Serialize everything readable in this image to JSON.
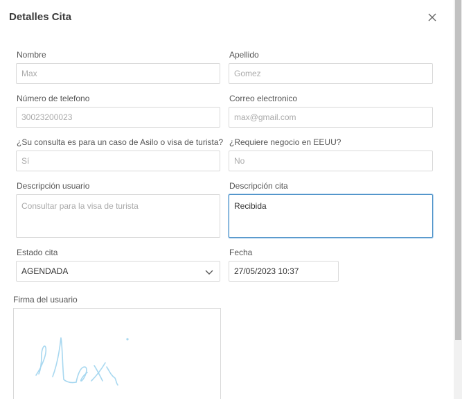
{
  "modal": {
    "title": "Detalles Cita"
  },
  "fields": {
    "nombre": {
      "label": "Nombre",
      "value": "Max"
    },
    "apellido": {
      "label": "Apellido",
      "value": "Gomez"
    },
    "telefono": {
      "label": "Número de telefono",
      "value": "30023200023"
    },
    "correo": {
      "label": "Correo electronico",
      "value": "max@gmail.com"
    },
    "asilo": {
      "label": "¿Su consulta es para un caso de Asilo o visa de turista?",
      "value": "Sí"
    },
    "negocio": {
      "label": "¿Requiere negocio en EEUU?",
      "value": "No"
    },
    "desc_usuario": {
      "label": "Descripción usuario",
      "value": "Consultar para la visa de turista"
    },
    "desc_cita": {
      "label": "Descripción cita",
      "value": "Recibida"
    },
    "estado": {
      "label": "Estado cita",
      "value": "AGENDADA"
    },
    "fecha": {
      "label": "Fecha",
      "value": "27/05/2023 10:37"
    },
    "firma": {
      "label": "Firma del usuario"
    }
  },
  "colors": {
    "focus_border": "#4a90c8",
    "signature_ink": "#a8d8f0"
  },
  "icons": {
    "close": "close-icon",
    "select": "chevron-down-icon"
  }
}
